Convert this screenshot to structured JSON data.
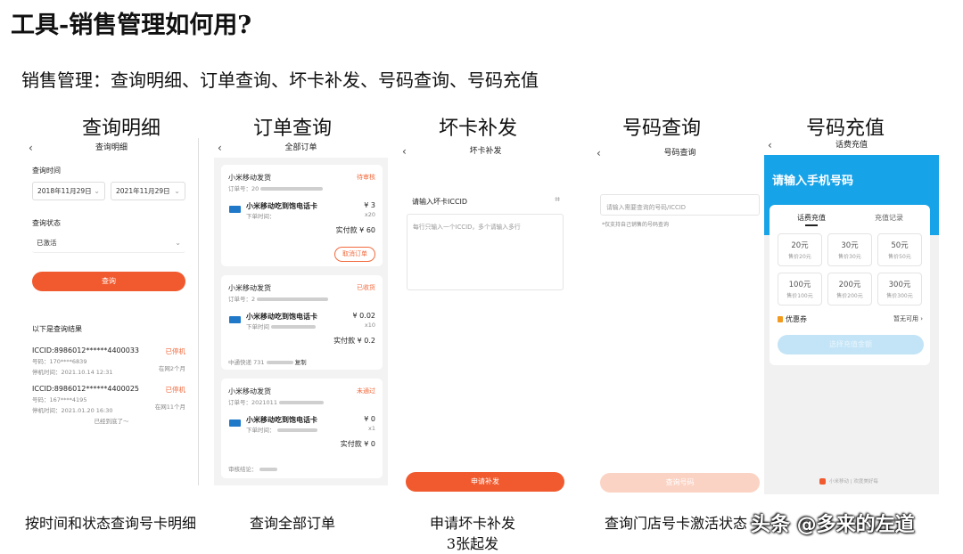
{
  "title": "工具-销售管理如何用?",
  "subtitle": "销售管理：查询明细、订单查询、坏卡补发、号码查询、号码充值",
  "sections": {
    "s1": "查询明细",
    "s2": "订单查询",
    "s3": "坏卡补发",
    "s4": "号码查询",
    "s5": "号码充值"
  },
  "captions": {
    "c1": "按时间和状态查询号卡明细",
    "c2": "查询全部订单",
    "c3a": "申请坏卡补发",
    "c3b": "3张起发",
    "c4": "查询门店号卡激活状态"
  },
  "watermark": "头条 @多来的左道",
  "p1": {
    "header": "查询明细",
    "time_label": "查询时间",
    "date_from": "2018年11月29日",
    "date_to": "2021年11月29日",
    "status_label": "查询状态",
    "status_value": "已激活",
    "query_btn": "查询",
    "results_label": "以下是查询结果",
    "results": [
      {
        "iccid": "ICCID:8986012******4400033",
        "status": "已停机",
        "number": "号码：170****6839",
        "time": "停机时间：2021.10.14 12:31",
        "net": "在网2个月"
      },
      {
        "iccid": "ICCID:8986012******4400025",
        "status": "已停机",
        "number": "号码：167****4195",
        "time": "停机时间：2021.01.20 16:30",
        "net": "在网11个月"
      }
    ],
    "end_text": "已经到底了～"
  },
  "p2": {
    "header": "全部订单",
    "orders": [
      {
        "name": "小米移动发货",
        "status": "待审核",
        "order_no": "订单号：20",
        "product": "小米移动吃到饱电话卡",
        "order_time": "下单时间：",
        "price": "¥ 3",
        "qty": "x20",
        "paid": "实付款 ¥ 60",
        "cancel": "取消订单"
      },
      {
        "name": "小米移动发货",
        "status": "已收货",
        "order_no": "订单号：2",
        "product": "小米移动吃到饱电话卡",
        "order_time": "下单时间",
        "price": "¥ 0.02",
        "qty": "x10",
        "paid": "实付款 ¥ 0.2",
        "express": "中通快递 731",
        "copy": "复制"
      },
      {
        "name": "小米移动发货",
        "status": "未通过",
        "order_no": "订单号：2021011",
        "product": "小米移动吃到饱电话卡",
        "order_time": "下单时间：",
        "price": "¥ 0",
        "qty": "x1",
        "paid": "实付款 ¥ 0",
        "review": "审核结论："
      }
    ]
  },
  "p3": {
    "header": "坏卡补发",
    "input_label": "请输入坏卡ICCID",
    "placeholder": "每行只输入一个ICCID，多个请输入多行",
    "submit": "申请补发"
  },
  "p4": {
    "header": "号码查询",
    "placeholder": "请输入需要查询的号码/ICCID",
    "hint": "*仅支持自己销售的号码查询",
    "submit": "查询号码"
  },
  "p5": {
    "header": "话费充值",
    "banner": "请输入手机号码",
    "tab_active": "话费充值",
    "tab_other": "充值记录",
    "tiles": [
      {
        "amount": "20元",
        "price": "售价20元"
      },
      {
        "amount": "30元",
        "price": "售价30元"
      },
      {
        "amount": "50元",
        "price": "售价50元"
      },
      {
        "amount": "100元",
        "price": "售价100元"
      },
      {
        "amount": "200元",
        "price": "售价200元"
      },
      {
        "amount": "300元",
        "price": "售价300元"
      }
    ],
    "coupon_label": "优惠券",
    "coupon_value": "暂无可用",
    "pay_btn": "选择充值金额",
    "footer": "小米移动 | 欢度美好每"
  },
  "colors": {
    "accent": "#f15a2e",
    "banner": "#17a3e8"
  }
}
